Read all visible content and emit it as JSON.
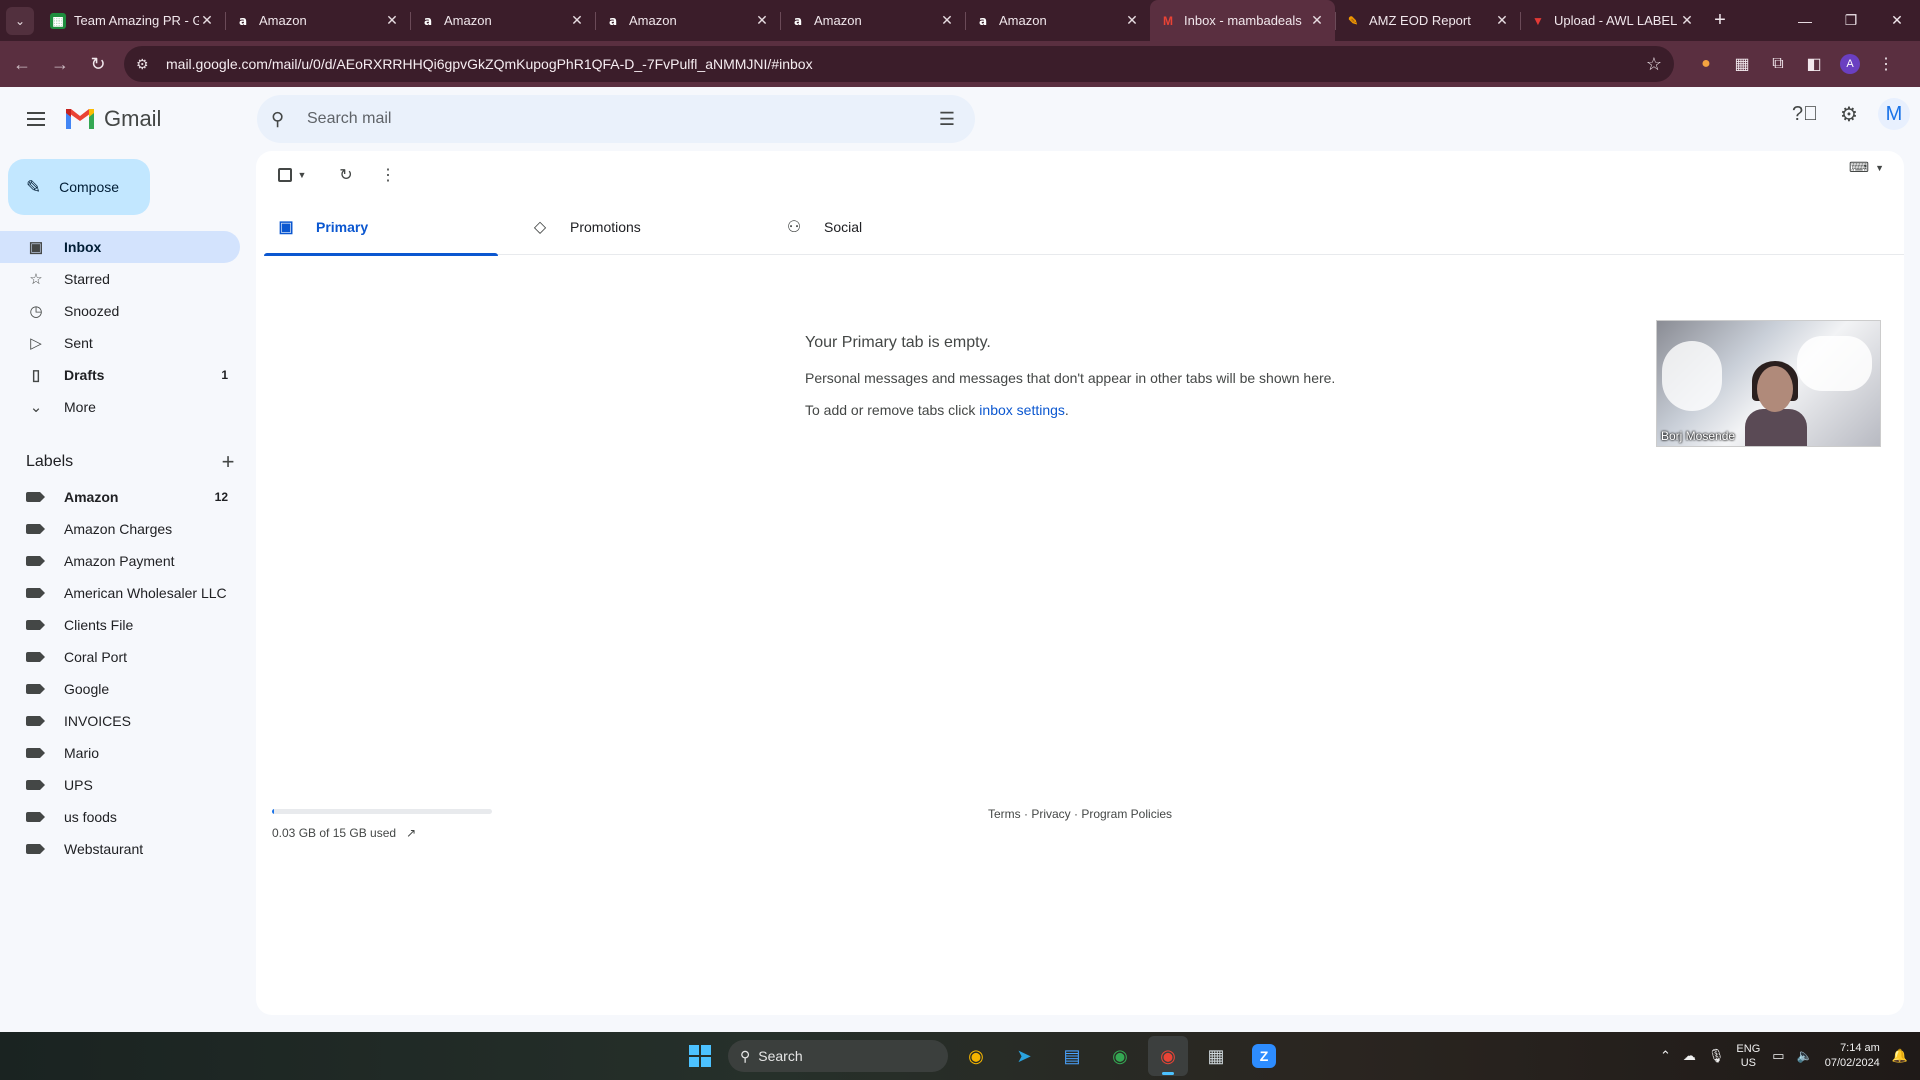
{
  "browser": {
    "tabs": [
      {
        "label": "Team Amazing PR - G",
        "icon": "sheets-icon"
      },
      {
        "label": "Amazon",
        "icon": "amazon-icon"
      },
      {
        "label": "Amazon",
        "icon": "amazon-icon"
      },
      {
        "label": "Amazon",
        "icon": "amazon-icon"
      },
      {
        "label": "Amazon",
        "icon": "amazon-icon"
      },
      {
        "label": "Amazon",
        "icon": "amazon-icon"
      },
      {
        "label": "Inbox - mambadeals",
        "icon": "gmail-icon",
        "active": true
      },
      {
        "label": "AMZ EOD Report",
        "icon": "report-icon"
      },
      {
        "label": "Upload - AWL LABEL",
        "icon": "upload-icon"
      }
    ],
    "url": "mail.google.com/mail/u/0/d/AEoRXRRHHQi6gpvGkZQmKupogPhR1QFA-D_-7FvPulfl_aNMMJNI/#inbox",
    "profile_initial": "A"
  },
  "gmail": {
    "app_name": "Gmail",
    "search_placeholder": "Search mail",
    "avatar_initial": "M",
    "compose_label": "Compose",
    "nav": [
      {
        "label": "Inbox",
        "icon": "inbox-icon",
        "count": "",
        "active": true
      },
      {
        "label": "Starred",
        "icon": "star-icon",
        "count": ""
      },
      {
        "label": "Snoozed",
        "icon": "clock-icon",
        "count": ""
      },
      {
        "label": "Sent",
        "icon": "send-icon",
        "count": ""
      },
      {
        "label": "Drafts",
        "icon": "draft-icon",
        "count": "1",
        "bold": true
      },
      {
        "label": "More",
        "icon": "chevron-down-icon",
        "count": ""
      }
    ],
    "labels_heading": "Labels",
    "labels": [
      {
        "label": "Amazon",
        "count": "12",
        "bold": true
      },
      {
        "label": "Amazon Charges",
        "count": ""
      },
      {
        "label": "Amazon Payment",
        "count": ""
      },
      {
        "label": "American Wholesaler LLC",
        "count": ""
      },
      {
        "label": "Clients File",
        "count": ""
      },
      {
        "label": "Coral Port",
        "count": ""
      },
      {
        "label": "Google",
        "count": ""
      },
      {
        "label": "INVOICES",
        "count": ""
      },
      {
        "label": "Mario",
        "count": ""
      },
      {
        "label": "UPS",
        "count": ""
      },
      {
        "label": "us foods",
        "count": ""
      },
      {
        "label": "Webstaurant",
        "count": ""
      }
    ],
    "tabs": [
      {
        "label": "Primary",
        "icon": "inbox-tab-icon",
        "active": true
      },
      {
        "label": "Promotions",
        "icon": "tag-icon"
      },
      {
        "label": "Social",
        "icon": "people-icon"
      }
    ],
    "empty": {
      "title": "Your Primary tab is empty.",
      "line1": "Personal messages and messages that don't appear in other tabs will be shown here.",
      "line2_prefix": "To add or remove tabs click ",
      "line2_link": "inbox settings",
      "line2_suffix": "."
    },
    "storage": {
      "text": "0.03 GB of 15 GB used",
      "fraction": 0.002
    },
    "footer": "Terms · Privacy · Program Policies"
  },
  "video_overlay": {
    "name": "Borj Mosende"
  },
  "taskbar": {
    "search_label": "Search",
    "lang_line1": "ENG",
    "lang_line2": "US",
    "time": "7:14 am",
    "date": "07/02/2024"
  },
  "colors": {
    "chrome_tab_bg": "#3b1d2a",
    "chrome_toolbar": "#5a2f40",
    "gmail_accent": "#0b57d0",
    "compose_bg": "#c2e7ff",
    "nav_active": "#d3e3fd"
  }
}
